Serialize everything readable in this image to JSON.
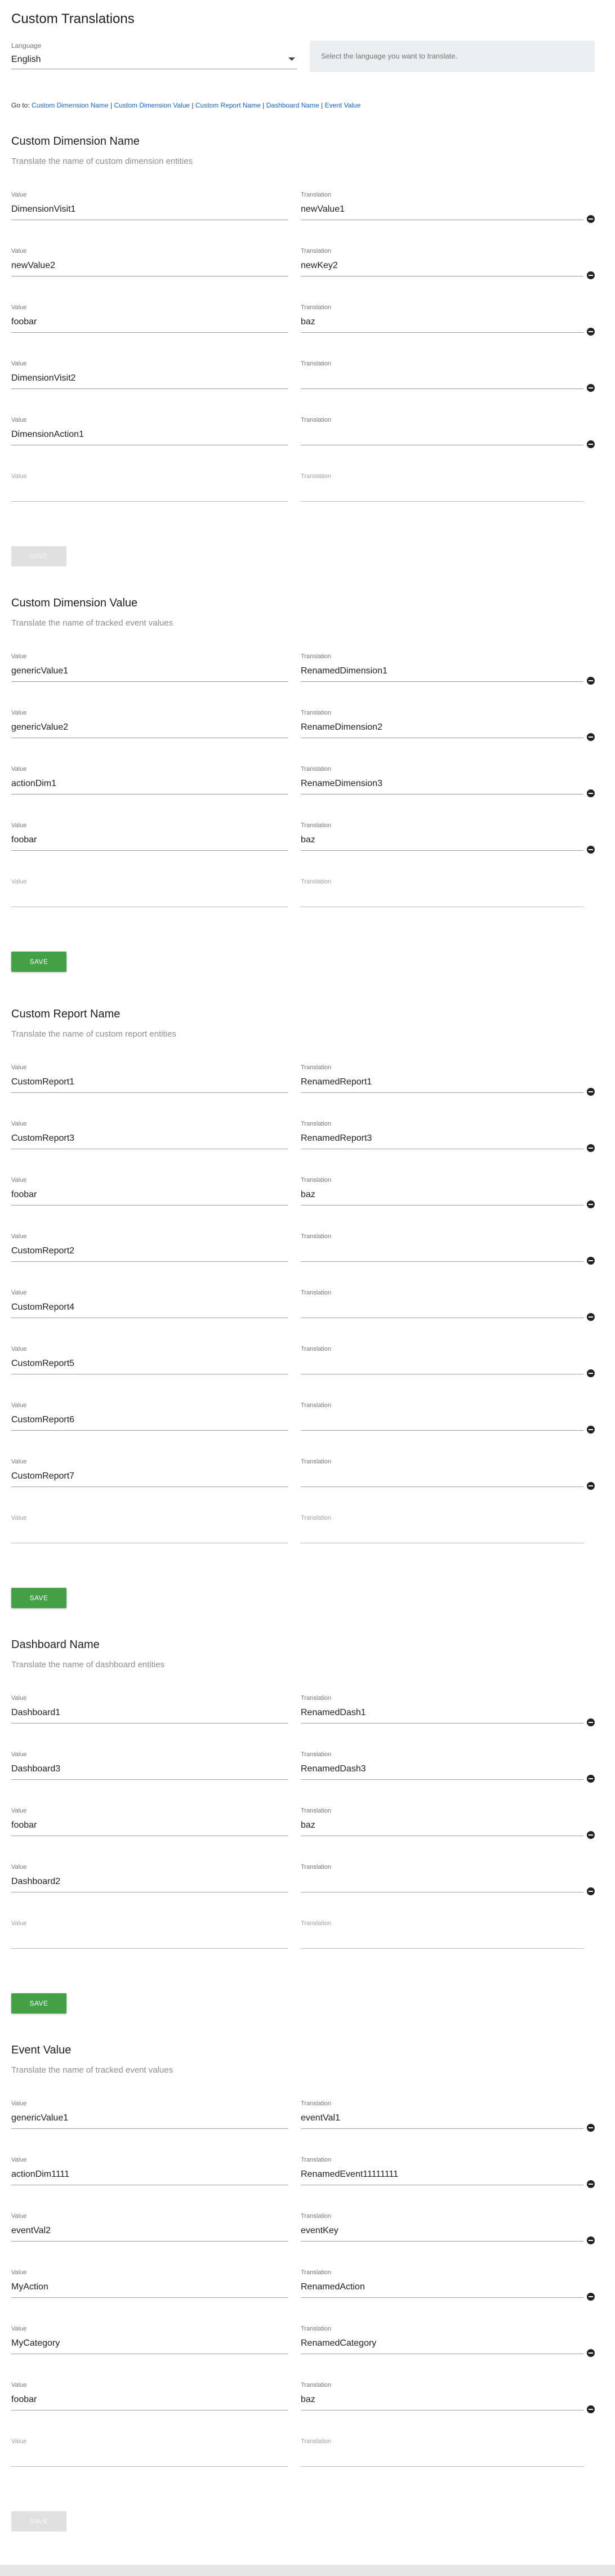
{
  "page": {
    "title": "Custom Translations"
  },
  "language": {
    "label": "Language",
    "selected": "English",
    "help": "Select the language you want to translate."
  },
  "goto": {
    "prefix": "Go to:",
    "links": [
      "Custom Dimension Name",
      "Custom Dimension Value",
      "Custom Report Name",
      "Dashboard Name",
      "Event Value"
    ],
    "separator": "|"
  },
  "labels": {
    "value": "Value",
    "translation": "Translation",
    "save": "SAVE"
  },
  "sections": [
    {
      "title": "Custom Dimension Name",
      "desc": "Translate the name of custom dimension entities",
      "rows": [
        [
          "DimensionVisit1",
          "newValue1"
        ],
        [
          "newValue2",
          "newKey2"
        ],
        [
          "foobar",
          "baz"
        ],
        [
          "DimensionVisit2",
          ""
        ],
        [
          "DimensionAction1",
          ""
        ]
      ],
      "save_enabled": false
    },
    {
      "title": "Custom Dimension Value",
      "desc": "Translate the name of tracked event values",
      "rows": [
        [
          "genericValue1",
          "RenamedDimension1"
        ],
        [
          "genericValue2",
          "RenameDimension2"
        ],
        [
          "actionDim1",
          "RenameDimension3"
        ],
        [
          "foobar",
          "baz"
        ]
      ],
      "save_enabled": true
    },
    {
      "title": "Custom Report Name",
      "desc": "Translate the name of custom report entities",
      "rows": [
        [
          "CustomReport1",
          "RenamedReport1"
        ],
        [
          "CustomReport3",
          "RenamedReport3"
        ],
        [
          "foobar",
          "baz"
        ],
        [
          "CustomReport2",
          ""
        ],
        [
          "CustomReport4",
          ""
        ],
        [
          "CustomReport5",
          ""
        ],
        [
          "CustomReport6",
          ""
        ],
        [
          "CustomReport7",
          ""
        ]
      ],
      "save_enabled": true
    },
    {
      "title": "Dashboard Name",
      "desc": "Translate the name of dashboard entities",
      "rows": [
        [
          "Dashboard1",
          "RenamedDash1"
        ],
        [
          "Dashboard3",
          "RenamedDash3"
        ],
        [
          "foobar",
          "baz"
        ],
        [
          "Dashboard2",
          ""
        ]
      ],
      "save_enabled": true
    },
    {
      "title": "Event Value",
      "desc": "Translate the name of tracked event values",
      "rows": [
        [
          "genericValue1",
          "eventVal1"
        ],
        [
          "actionDim1111",
          "RenamedEvent11111111"
        ],
        [
          "eventVal2",
          "eventKey"
        ],
        [
          "MyAction",
          "RenamedAction"
        ],
        [
          "MyCategory",
          "RenamedCategory"
        ],
        [
          "foobar",
          "baz"
        ]
      ],
      "save_enabled": false
    }
  ],
  "colors": {
    "accent_green": "#43a047",
    "link_blue": "#1565c0"
  },
  "icons": {
    "delete": "minus-circle-icon",
    "dropdown": "caret-down-icon"
  }
}
